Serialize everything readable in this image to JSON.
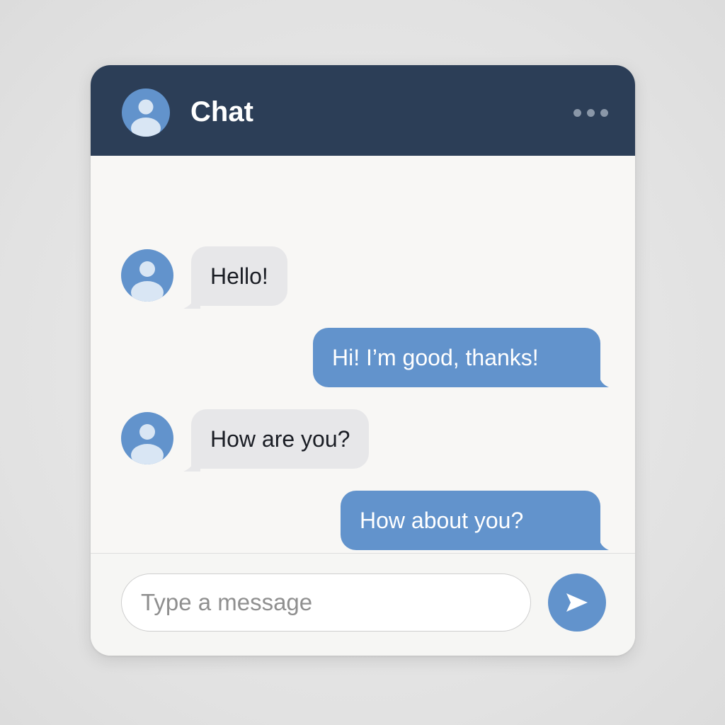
{
  "header": {
    "title": "Chat",
    "avatar_icon": "user-avatar-icon",
    "menu_icon": "more-horizontal-icon"
  },
  "messages": [
    {
      "direction": "received",
      "text": "Hello!"
    },
    {
      "direction": "sent",
      "text": "Hi! I’m good, thanks!"
    },
    {
      "direction": "received",
      "text": "How are you?"
    },
    {
      "direction": "sent",
      "text": "How about you?"
    }
  ],
  "composer": {
    "placeholder": "Type a message",
    "value": "",
    "send_icon": "send-icon"
  },
  "colors": {
    "header_bg": "#2c3e57",
    "accent": "#6293cc",
    "received_bubble": "#e7e7e9",
    "window_bg": "#f8f7f5"
  }
}
